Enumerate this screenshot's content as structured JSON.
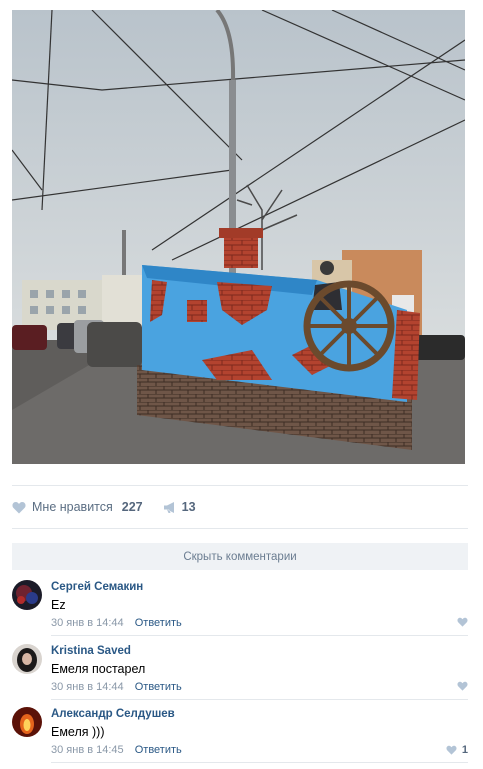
{
  "post": {
    "photo_icon": "parade-float-photo",
    "like_icon": "heart-icon",
    "like_label": "Мне нравится",
    "like_count": "227",
    "share_icon": "megaphone-icon",
    "share_count": "13"
  },
  "comments_toggle": {
    "label": "Скрыть комментарии"
  },
  "comments": [
    {
      "author": "Сергей Семакин",
      "text": "Ez",
      "date": "30 янв в 14:44",
      "reply": "Ответить",
      "likes": ""
    },
    {
      "author": "Kristina Saved",
      "text": "Емеля постарел",
      "date": "30 янв в 14:44",
      "reply": "Ответить",
      "likes": ""
    },
    {
      "author": "Александр Селдушев",
      "text": "Емеля )))",
      "date": "30 янв в 14:45",
      "reply": "Ответить",
      "likes": "1"
    }
  ],
  "colors": {
    "link": "#2a5885",
    "muted": "#8a98a8",
    "divider": "#e4e8ec",
    "bar": "#eff2f5"
  }
}
